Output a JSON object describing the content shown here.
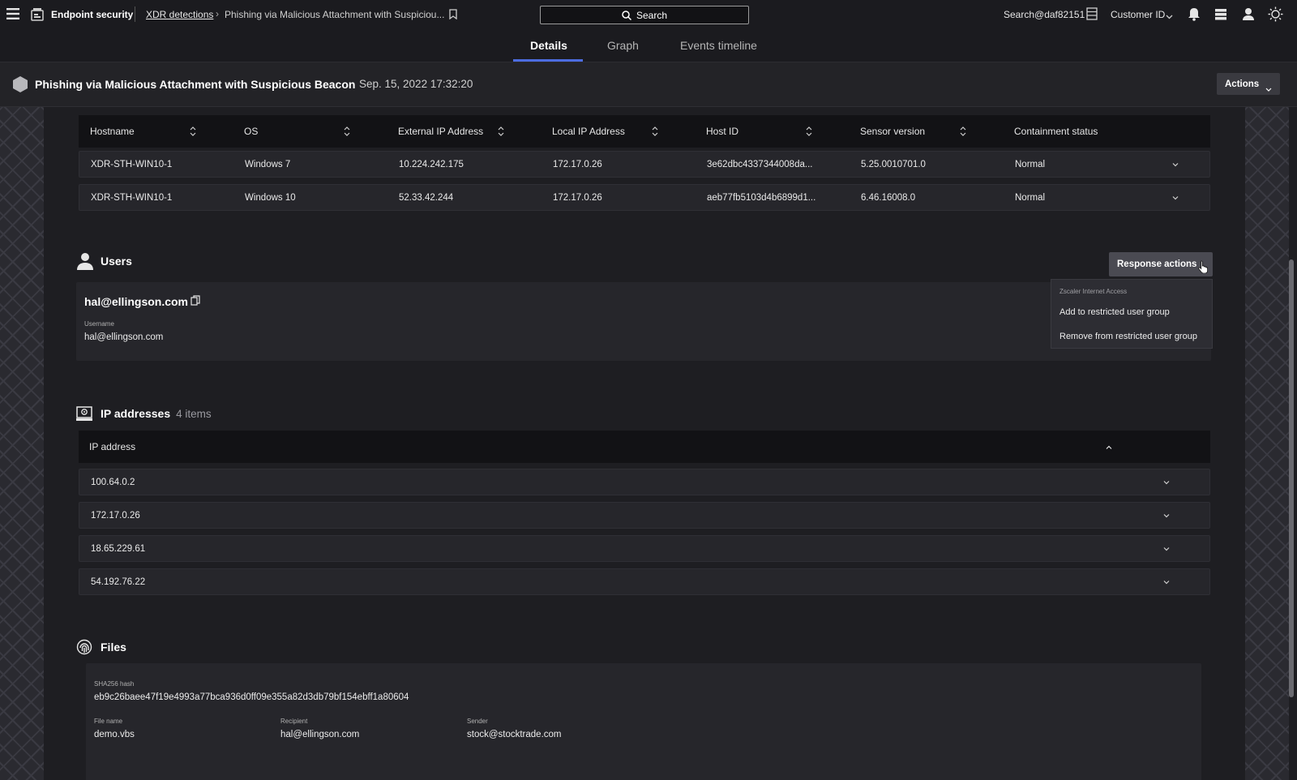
{
  "header": {
    "app_name": "Endpoint security",
    "breadcrumb_link": "XDR detections",
    "breadcrumb_current": "Phishing via Malicious Attachment with Suspiciou...",
    "search_label": "Search",
    "user_label": "Search@daf82151",
    "customer_label": "Customer ID"
  },
  "tabs": [
    {
      "label": "Details"
    },
    {
      "label": "Graph"
    },
    {
      "label": "Events timeline"
    }
  ],
  "detection": {
    "title": "Phishing via Malicious Attachment with Suspicious Beacon",
    "timestamp": "Sep. 15, 2022 17:32:20",
    "actions_label": "Actions"
  },
  "hosts": {
    "columns": [
      "Hostname",
      "OS",
      "External IP Address",
      "Local IP Address",
      "Host ID",
      "Sensor version",
      "Containment status"
    ],
    "rows": [
      [
        "XDR-STH-WIN10-1",
        "Windows 7",
        "10.224.242.175",
        "172.17.0.26",
        "3e62dbc4337344008da...",
        "5.25.0010701.0",
        "Normal"
      ],
      [
        "XDR-STH-WIN10-1",
        "Windows 10",
        "52.33.42.244",
        "172.17.0.26",
        "aeb77fb5103d4b6899d1...",
        "6.46.16008.0",
        "Normal"
      ]
    ]
  },
  "users": {
    "title": "Users",
    "email": "hal@ellingson.com",
    "username_label": "Username",
    "username": "hal@ellingson.com",
    "response_actions_label": "Response actions",
    "dropdown": {
      "group_label": "Zscaler Internet Access",
      "items": [
        "Add to restricted user group",
        "Remove from restricted user group"
      ]
    }
  },
  "ip_addresses": {
    "title": "IP addresses",
    "count_label": "4 items",
    "column": "IP address",
    "items": [
      "100.64.0.2",
      "172.17.0.26",
      "18.65.229.61",
      "54.192.76.22"
    ]
  },
  "files": {
    "title": "Files",
    "hash_label": "SHA256 hash",
    "hash": "eb9c26baee47f19e4993a77bca936d0ff09e355a82d3db79bf154ebff1a80604",
    "filename_label": "File name",
    "filename": "demo.vbs",
    "recipient_label": "Recipient",
    "recipient": "hal@ellingson.com",
    "sender_label": "Sender",
    "sender": "stock@stocktrade.com"
  },
  "colors": {
    "accent": "#4c6ce0",
    "background": "#1e1e22",
    "row_bg": "#26262b",
    "header_bg": "#121215"
  }
}
